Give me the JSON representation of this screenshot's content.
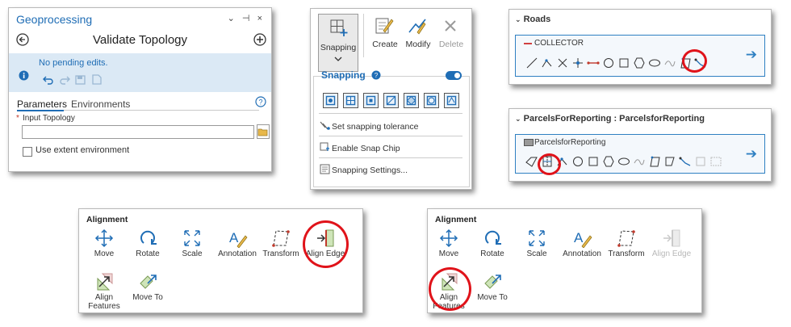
{
  "geoprocessing": {
    "title": "Geoprocessing",
    "window_controls": "⌄ ⊣ ×",
    "tool_name": "Validate Topology",
    "message": "No pending edits.",
    "tabs": [
      "Parameters",
      "Environments"
    ],
    "field_label": "Input Topology",
    "field_value": "",
    "required_mark": "*",
    "checkbox_label": "Use extent environment"
  },
  "snapping": {
    "buttons": {
      "snapping": "Snapping",
      "create": "Create",
      "modify": "Modify",
      "delete": "Delete"
    },
    "header": "Snapping",
    "menu": [
      "Set snapping tolerance",
      "Enable Snap Chip",
      "Snapping Settings..."
    ]
  },
  "roads": {
    "header": "Roads",
    "layer": "COLLECTOR"
  },
  "parcels": {
    "header": "ParcelsForReporting : ParcelsforReporting",
    "layer": "ParcelsforReporting"
  },
  "alignment_1": {
    "header": "Alignment",
    "tools": [
      "Move",
      "Rotate",
      "Scale",
      "Annotation",
      "Transform",
      "Align Edge",
      "Align Features",
      "Move To"
    ]
  },
  "alignment_2": {
    "header": "Alignment",
    "tools": [
      "Move",
      "Rotate",
      "Scale",
      "Annotation",
      "Transform",
      "Align Edge",
      "Align Features",
      "Move To"
    ]
  },
  "colors": {
    "accent": "#1f6db5",
    "highlight": "#e0131a",
    "message_bg": "#dbe9f5"
  }
}
